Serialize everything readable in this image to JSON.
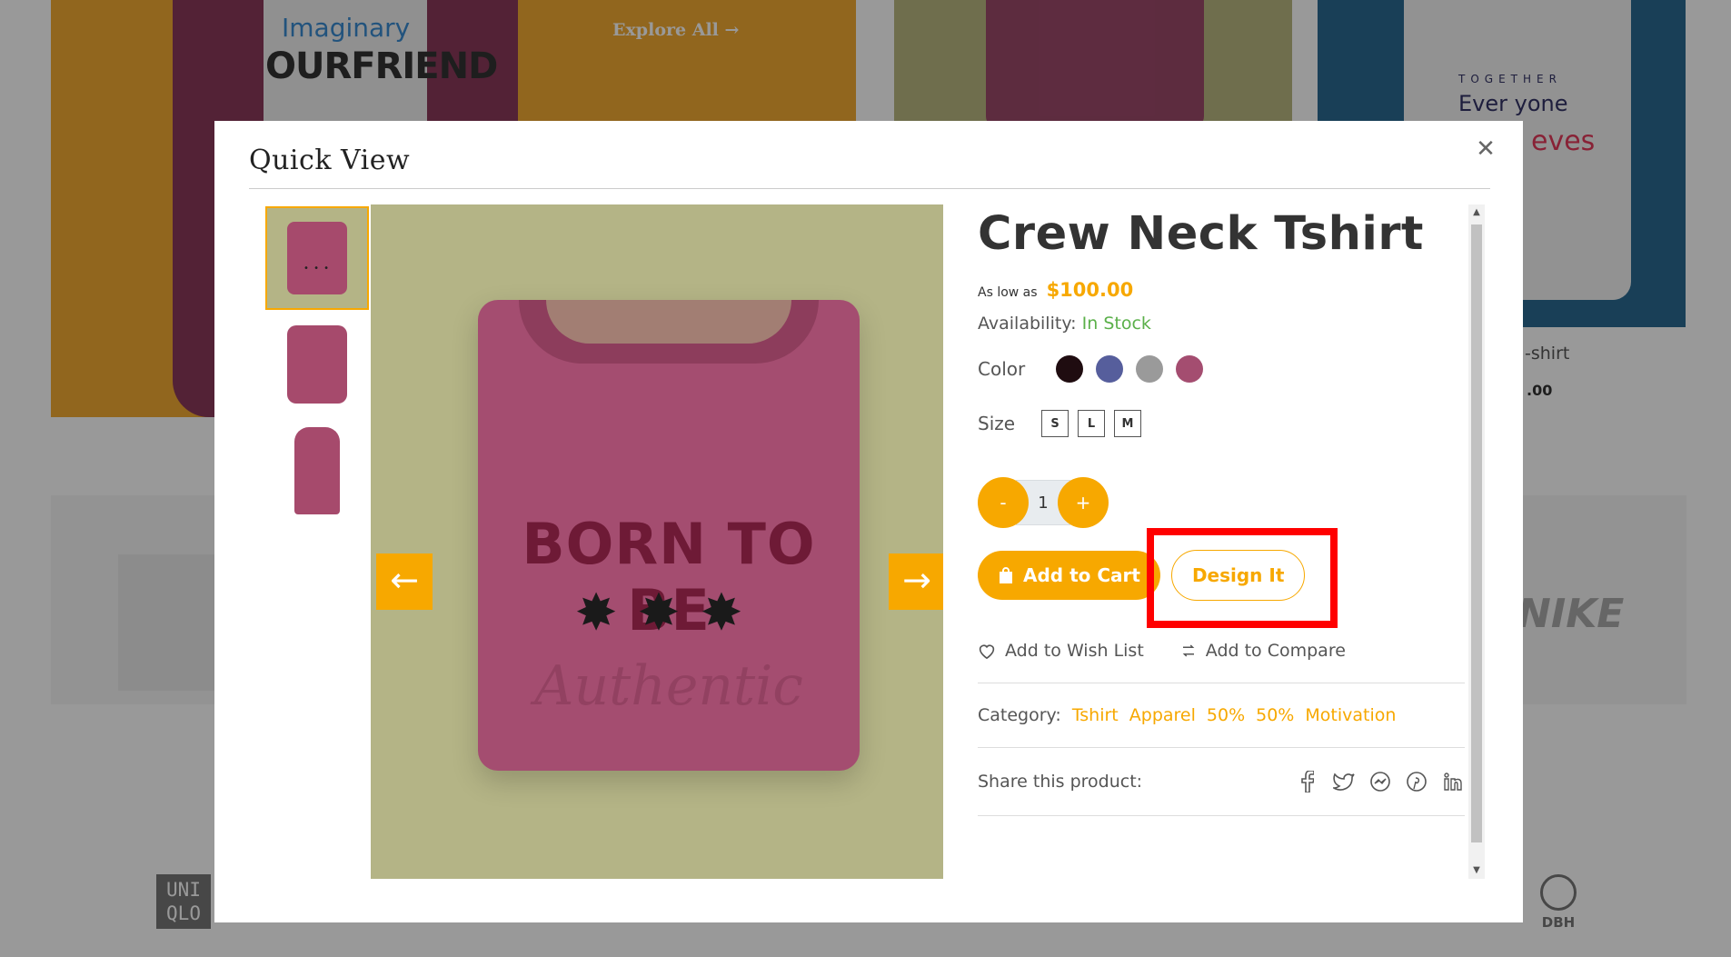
{
  "background": {
    "explore_label": "Explore All",
    "hoodie_text_1": "Imaginary",
    "hoodie_text_2": "OURFRIEND",
    "tshirt_text_1": "TOGETHER",
    "tshirt_text_2": "Ever yone",
    "tshirt_text_3": "eves",
    "product_name": "-shirt",
    "product_price": ".00",
    "brand_nike": "NIKE",
    "brand_uniqlo": "UNI QLO",
    "brand_dbh": "DBH"
  },
  "modal": {
    "title": "Quick View",
    "close_icon": "close-icon"
  },
  "product": {
    "title": "Crew Neck Tshirt",
    "as_low_as": "As low as",
    "price": "$100.00",
    "availability_label": "Availability:",
    "availability_value": "In Stock",
    "image_text_1": "BORN TO BE",
    "image_text_2": "✸✸✸",
    "image_text_3": "Authentic"
  },
  "options": {
    "color_label": "Color",
    "colors": [
      "#1f0c10",
      "#565e9c",
      "#9a9a9a",
      "#a44d70"
    ],
    "size_label": "Size",
    "sizes": [
      "S",
      "L",
      "M"
    ]
  },
  "quantity": {
    "minus": "-",
    "value": "1",
    "plus": "+"
  },
  "actions": {
    "add_to_cart": "Add to Cart",
    "design_it": "Design It",
    "wishlist": "Add to Wish List",
    "compare": "Add to Compare"
  },
  "category": {
    "label": "Category:",
    "items": [
      "Tshirt",
      "Apparel",
      "50%",
      "50%",
      "Motivation"
    ]
  },
  "share": {
    "label": "Share this product:",
    "icons": [
      "facebook-icon",
      "twitter-icon",
      "messenger-icon",
      "pinterest-icon",
      "linkedin-icon"
    ]
  },
  "colors": {
    "accent": "#f7a800",
    "stock": "#5bb04a",
    "highlight": "#ff0000"
  }
}
